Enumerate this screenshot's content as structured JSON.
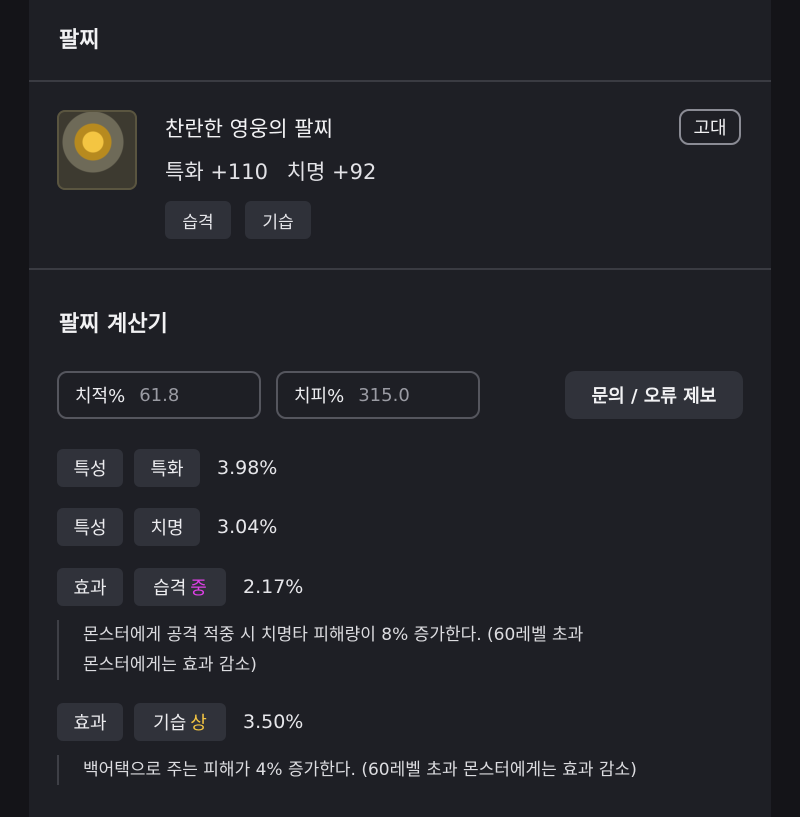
{
  "header": {
    "title": "팔찌"
  },
  "item": {
    "name": "찬란한 영웅의 팔찌",
    "grade": "고대",
    "stats": [
      {
        "label": "특화 +110"
      },
      {
        "label": "치명 +92"
      }
    ],
    "tags": [
      "습격",
      "기습"
    ]
  },
  "calculator": {
    "title": "팔찌 계산기",
    "crit_rate": {
      "label": "치적%",
      "value": "61.8"
    },
    "crit_dmg": {
      "label": "치피%",
      "value": "315.0"
    },
    "report_button": "문의 / 오류 제보",
    "rows": [
      {
        "type": "특성",
        "name": "특화",
        "grade": "",
        "percent": "3.98%"
      },
      {
        "type": "특성",
        "name": "치명",
        "grade": "",
        "percent": "3.04%"
      },
      {
        "type": "효과",
        "name": "습격",
        "grade": "중",
        "percent": "2.17%",
        "desc": [
          "몬스터에게 공격 적중 시 치명타 피해량이 8% 증가한다. (60레벨 초과",
          "몬스터에게는 효과 감소)"
        ]
      },
      {
        "type": "효과",
        "name": "기습",
        "grade": "상",
        "percent": "3.50%",
        "desc": [
          "백어택으로 주는 피해가 4% 증가한다. (60레벨 초과 몬스터에게는 효과 감소)"
        ]
      }
    ]
  },
  "colors": {
    "grade_mid": "#e040e8",
    "grade_high": "#f4c542"
  }
}
